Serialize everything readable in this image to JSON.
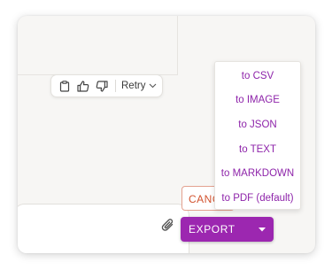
{
  "feedback_bar": {
    "icons": [
      "clipboard-icon",
      "thumbs-up-icon",
      "thumbs-down-icon"
    ],
    "retry_label": "Retry"
  },
  "actions": {
    "cancel_label": "CANCEL",
    "export_label": "EXPORT"
  },
  "export_menu": {
    "items": [
      "to CSV",
      "to IMAGE",
      "to JSON",
      "to TEXT",
      "to MARKDOWN",
      "to PDF (default)"
    ]
  },
  "colors": {
    "accent": "#9c27b0",
    "menu_text": "#8e24aa",
    "cancel": "#d2532f",
    "panel_bg": "#f7f6f4"
  }
}
